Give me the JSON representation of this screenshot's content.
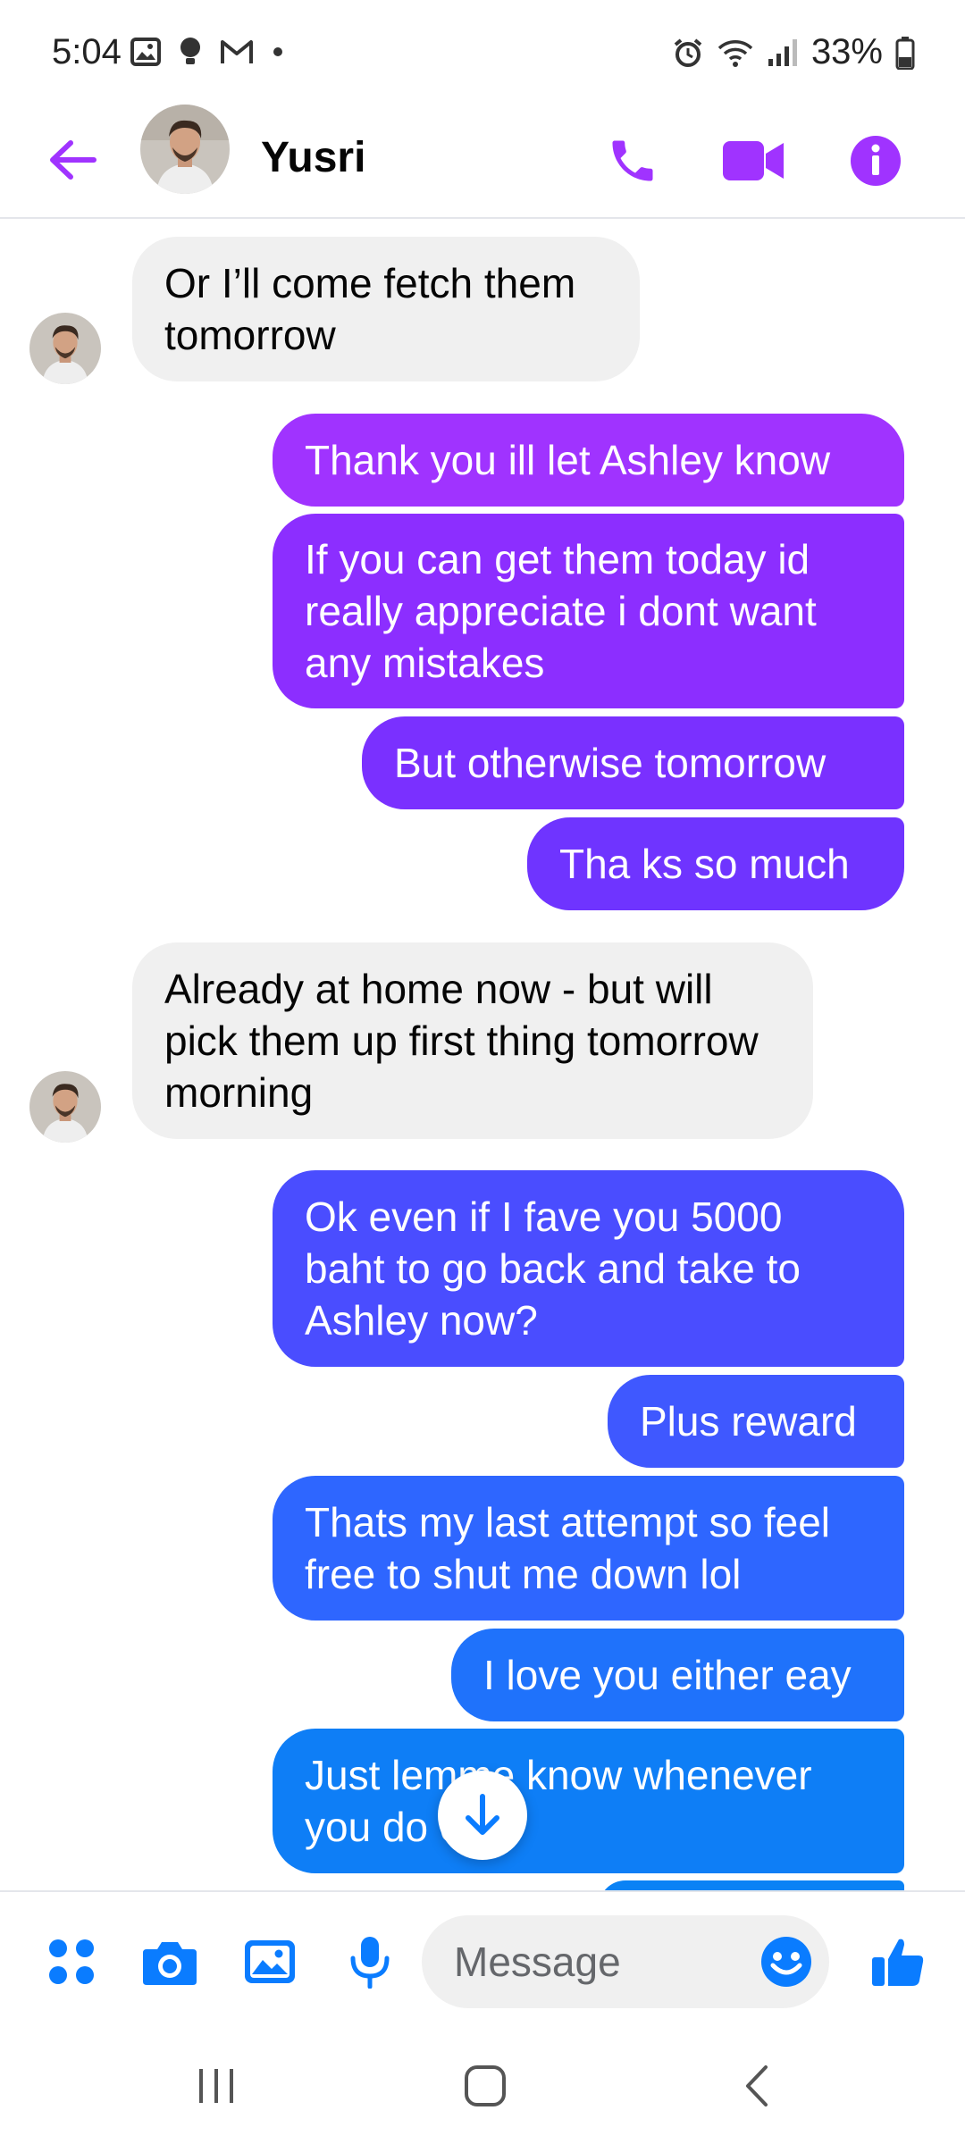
{
  "status_bar": {
    "time": "5:04",
    "battery": "33%"
  },
  "header": {
    "contact_name": "Yusri",
    "accent_color": "#a033ff"
  },
  "messages": [
    {
      "id": "m1",
      "direction": "incoming",
      "text": "Or I’ll come fetch them tomorrow"
    },
    {
      "id": "m2",
      "direction": "outgoing",
      "text": "Thank you ill let Ashley know",
      "color": "#a033ff"
    },
    {
      "id": "m3",
      "direction": "outgoing",
      "text": "If you can get them today id really appreciate i dont want any mistakes",
      "color": "#8c2eff"
    },
    {
      "id": "m4",
      "direction": "outgoing",
      "text": "But otherwise tomorrow",
      "color": "#7a30ff"
    },
    {
      "id": "m5",
      "direction": "outgoing",
      "text": "Tha ks so much",
      "color": "#6f34ff"
    },
    {
      "id": "m6",
      "direction": "incoming",
      "text": "Already at home now - but will pick them up first thing tomorrow morning"
    },
    {
      "id": "m7",
      "direction": "outgoing",
      "text": "Ok even if I fave you 5000 baht to go back and take to Ashley now?",
      "color": "#4a4dff"
    },
    {
      "id": "m8",
      "direction": "outgoing",
      "text": "Plus reward",
      "color": "#3f58ff"
    },
    {
      "id": "m9",
      "direction": "outgoing",
      "text": "Thats my last attempt so feel free to shut me down lol",
      "color": "#2e66ff"
    },
    {
      "id": "m10",
      "direction": "outgoing",
      "text": "I love you either eay",
      "color": "#1f72fb"
    },
    {
      "id": "m11",
      "direction": "outgoing",
      "text": "Just lemme know whenever you do ect",
      "color": "#0e7ef6"
    }
  ],
  "composer": {
    "placeholder": "Message",
    "accent_color": "#0a7cff"
  },
  "icons": {
    "back": "back-arrow-icon",
    "call": "phone-icon",
    "video": "video-camera-icon",
    "info": "info-icon",
    "apps": "apps-grid-icon",
    "camera": "camera-icon",
    "gallery": "image-icon",
    "mic": "microphone-icon",
    "emoji": "emoji-icon",
    "like": "thumbs-up-icon",
    "scroll": "arrow-down-icon"
  }
}
